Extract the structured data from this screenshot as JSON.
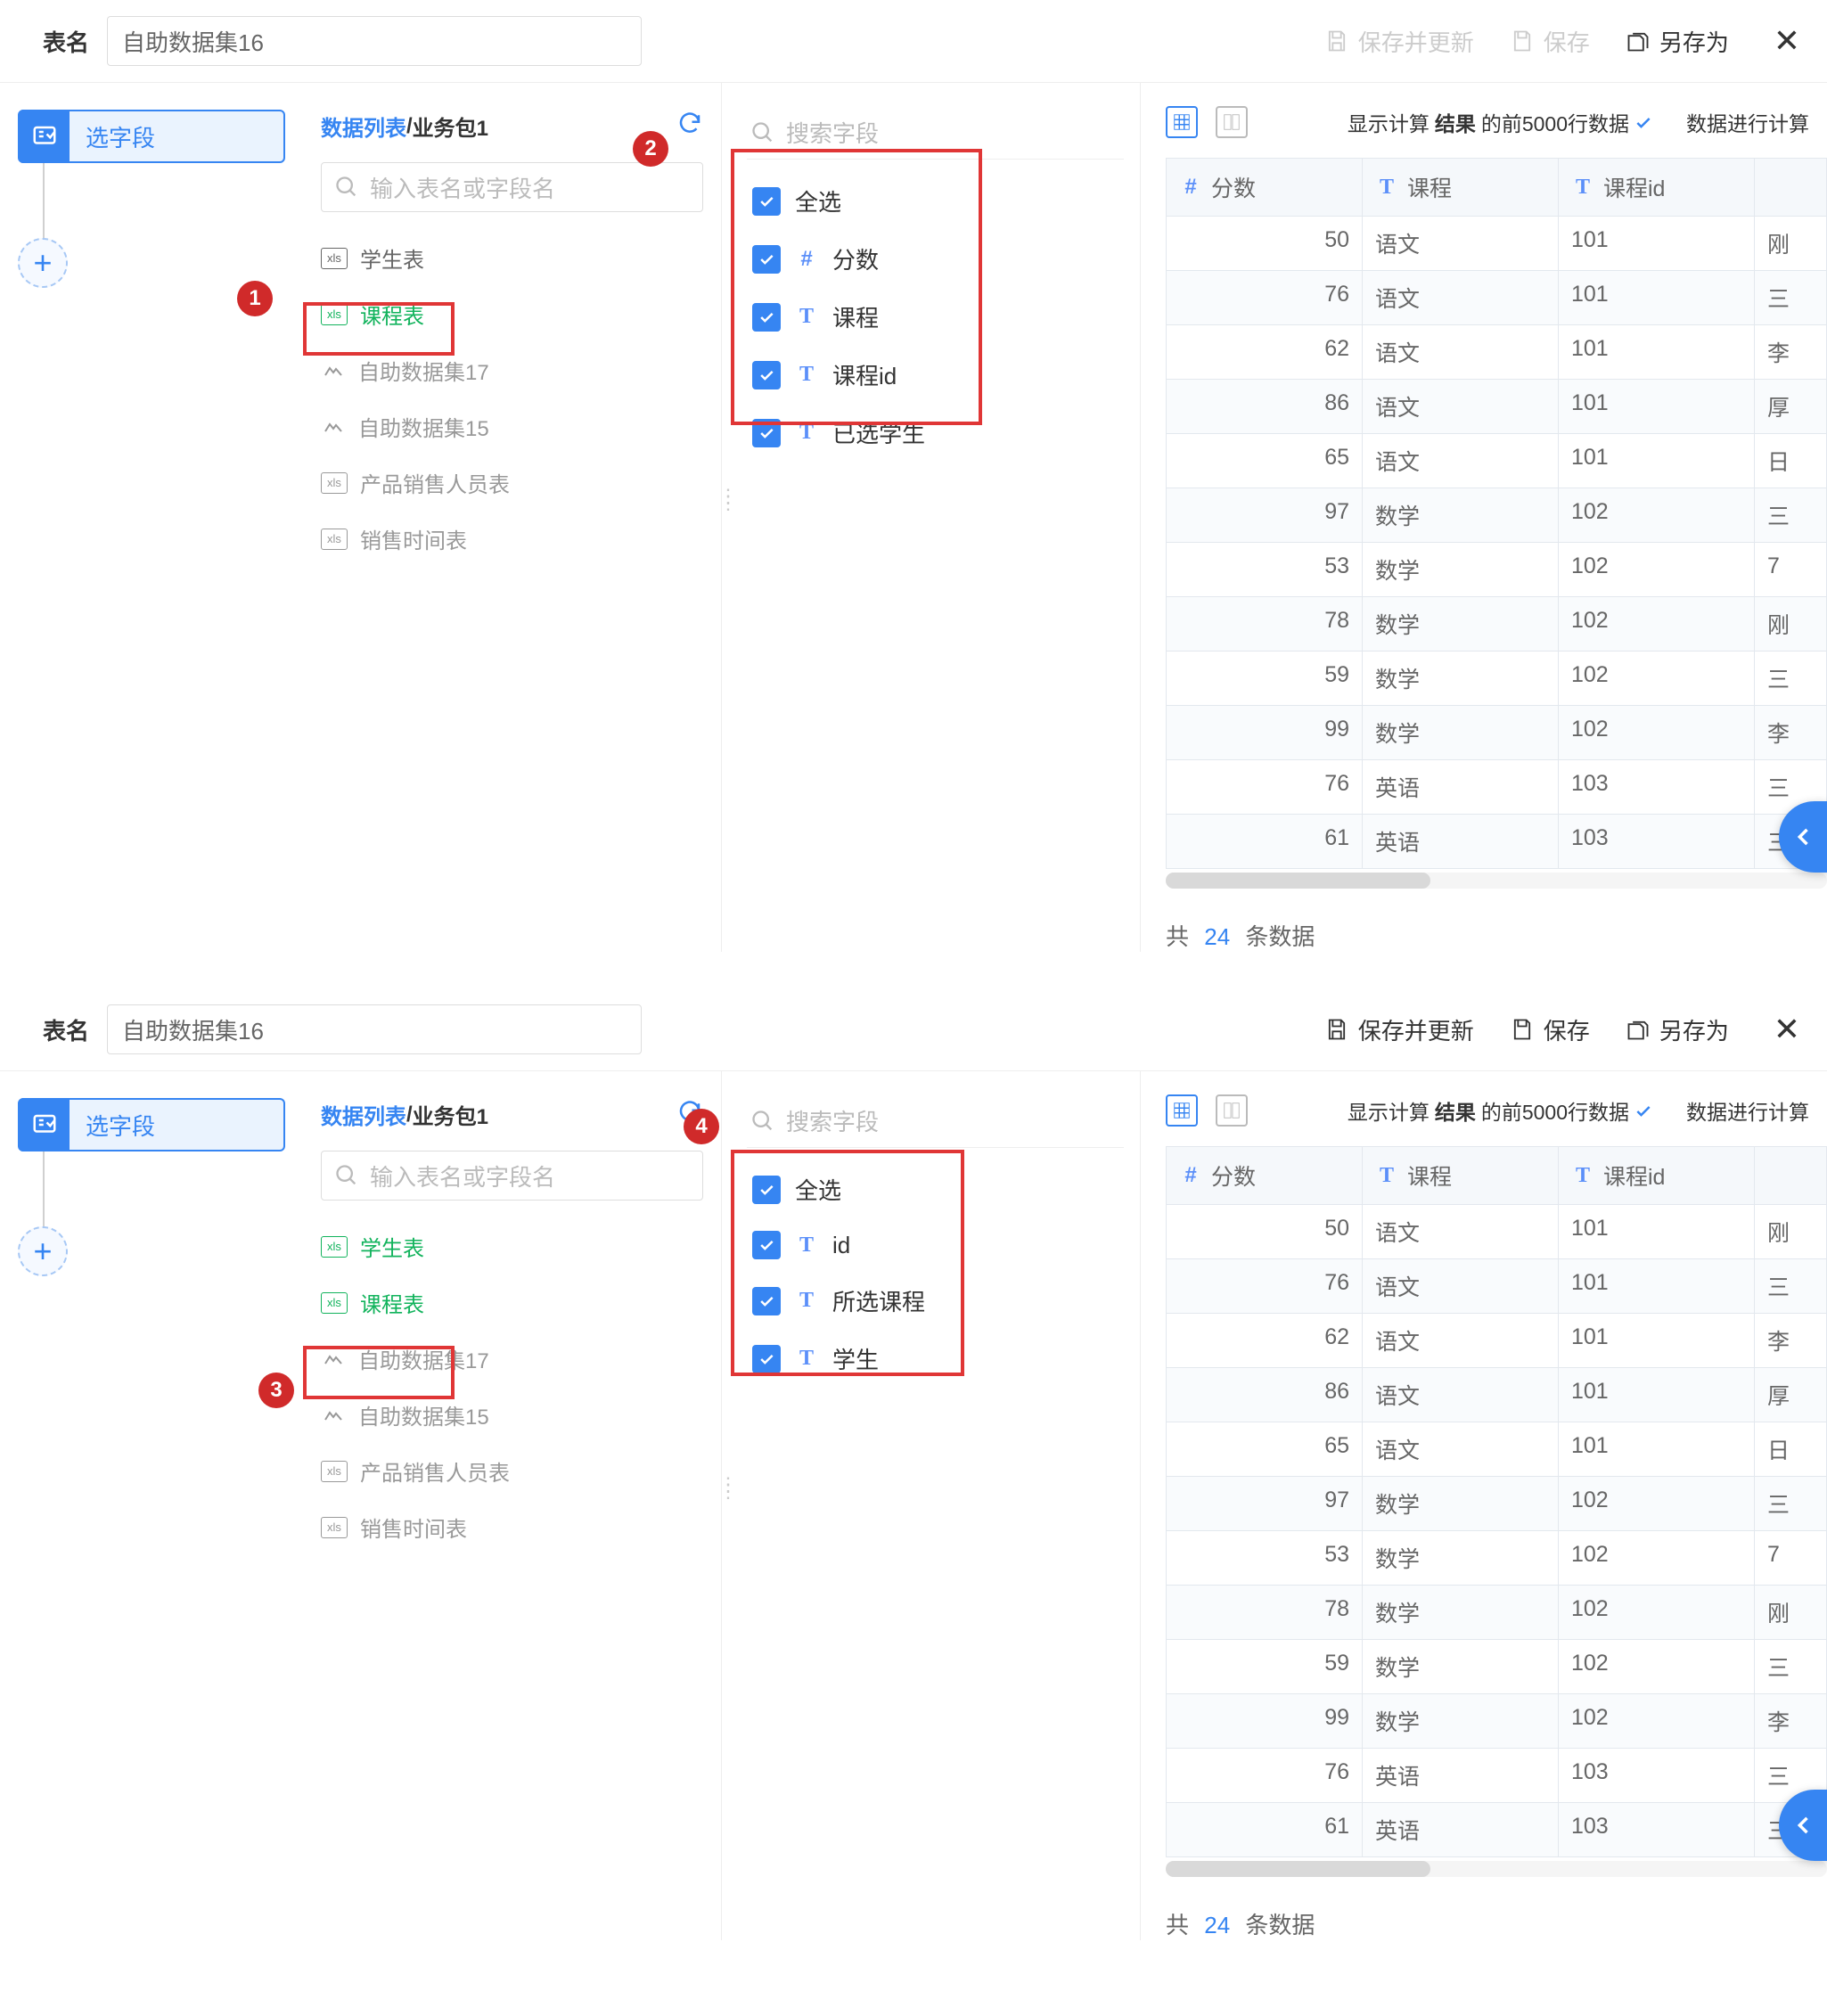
{
  "top": {
    "tableLabel": "表名",
    "tableName": "自助数据集16",
    "saveUpdate": "保存并更新",
    "save": "保存",
    "saveAs": "另存为"
  },
  "steps": {
    "selectFields": "选字段"
  },
  "tablesHeader": {
    "list": "数据列表",
    "sep": "/",
    "pkg": "业务包1"
  },
  "tableSearchPlaceholder": "输入表名或字段名",
  "tables": [
    {
      "icon": "xls",
      "label": "学生表"
    },
    {
      "icon": "xls",
      "label": "课程表"
    },
    {
      "icon": "ds",
      "label": "自助数据集17"
    },
    {
      "icon": "ds",
      "label": "自助数据集15"
    },
    {
      "icon": "xls",
      "label": "产品销售人员表"
    },
    {
      "icon": "xls",
      "label": "销售时间表"
    }
  ],
  "fieldSearchPlaceholder": "搜索字段",
  "fieldsA": [
    {
      "type": "",
      "label": "全选"
    },
    {
      "type": "num",
      "label": "分数"
    },
    {
      "type": "txt",
      "label": "课程"
    },
    {
      "type": "txt",
      "label": "课程id"
    },
    {
      "type": "txt",
      "label": "已选学生"
    }
  ],
  "fieldsB": [
    {
      "type": "",
      "label": "全选"
    },
    {
      "type": "txt",
      "label": "id"
    },
    {
      "type": "txt",
      "label": "所选课程"
    },
    {
      "type": "txt",
      "label": "学生"
    }
  ],
  "previewHeader": {
    "leftA": "显示计算",
    "bold": "结果",
    "leftB": "的前5000行数据",
    "right": "数据进行计算"
  },
  "columns": [
    {
      "type": "num",
      "label": "分数"
    },
    {
      "type": "txt",
      "label": "课程"
    },
    {
      "type": "txt",
      "label": "课程id"
    }
  ],
  "rows": [
    {
      "score": 50,
      "course": "语文",
      "cid": "101",
      "extra": "刚"
    },
    {
      "score": 76,
      "course": "语文",
      "cid": "101",
      "extra": "三"
    },
    {
      "score": 62,
      "course": "语文",
      "cid": "101",
      "extra": "李"
    },
    {
      "score": 86,
      "course": "语文",
      "cid": "101",
      "extra": "厚"
    },
    {
      "score": 65,
      "course": "语文",
      "cid": "101",
      "extra": "日"
    },
    {
      "score": 97,
      "course": "数学",
      "cid": "102",
      "extra": "三"
    },
    {
      "score": 53,
      "course": "数学",
      "cid": "102",
      "extra": "7"
    },
    {
      "score": 78,
      "course": "数学",
      "cid": "102",
      "extra": "刚"
    },
    {
      "score": 59,
      "course": "数学",
      "cid": "102",
      "extra": "三"
    },
    {
      "score": 99,
      "course": "数学",
      "cid": "102",
      "extra": "李"
    },
    {
      "score": 76,
      "course": "英语",
      "cid": "103",
      "extra": "三"
    },
    {
      "score": 61,
      "course": "英语",
      "cid": "103",
      "extra": "三"
    }
  ],
  "summary": {
    "prefix": "共",
    "count": "24",
    "suffix": "条数据"
  },
  "badges": {
    "b1": "1",
    "b2": "2",
    "b3": "3",
    "b4": "4"
  }
}
